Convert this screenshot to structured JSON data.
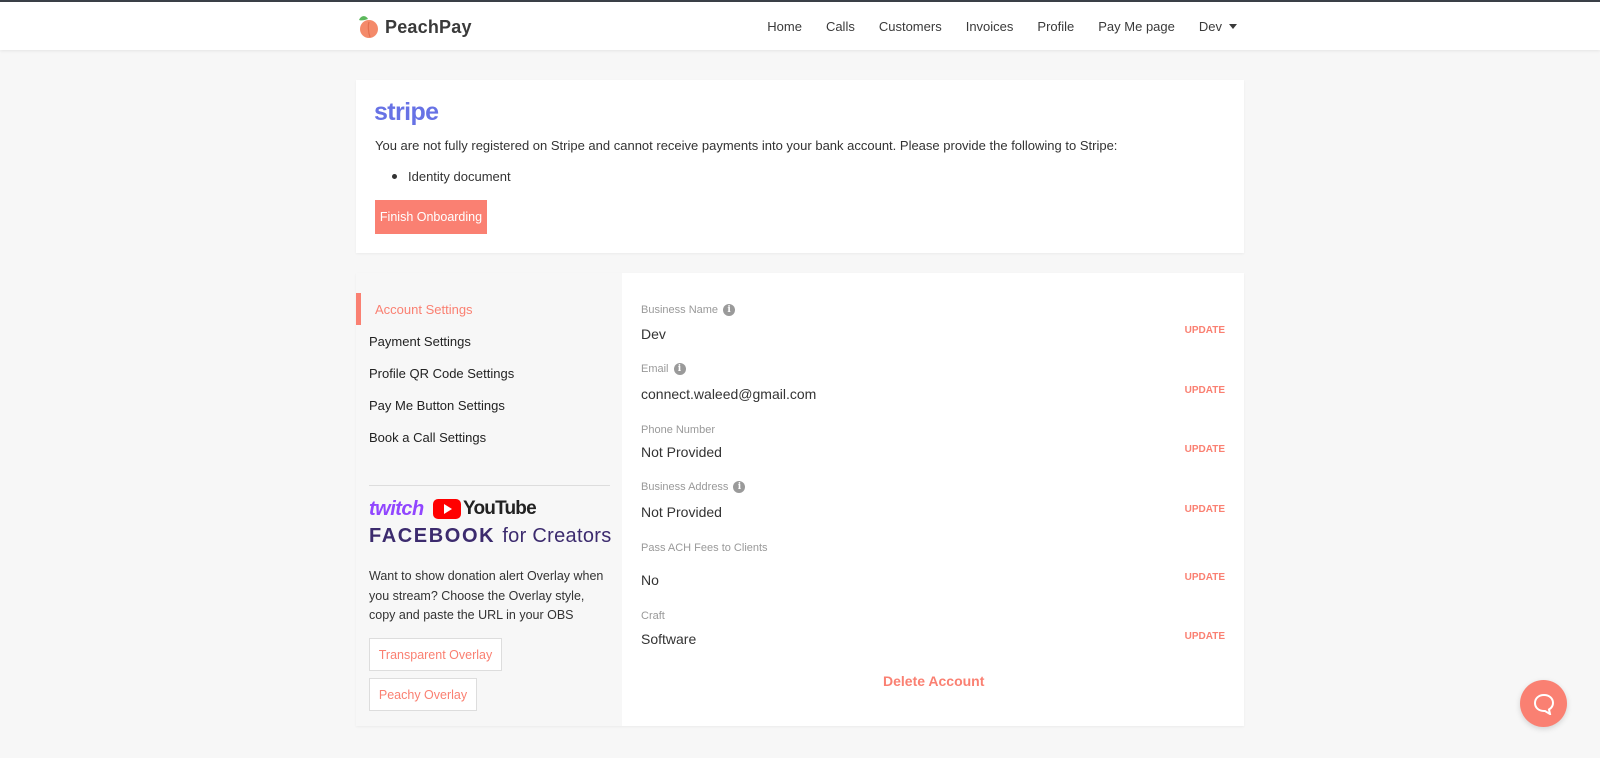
{
  "nav": {
    "brand": "PeachPay",
    "links": [
      "Home",
      "Calls",
      "Customers",
      "Invoices",
      "Profile",
      "Pay Me page"
    ],
    "user_menu": "Dev"
  },
  "stripe": {
    "logo": "stripe",
    "message": "You are not fully registered on Stripe and cannot receive payments into your bank account. Please provide the following to Stripe:",
    "requirements": [
      "Identity document"
    ],
    "button": "Finish Onboarding"
  },
  "sidebar": {
    "items": [
      "Account Settings",
      "Payment Settings",
      "Profile QR Code Settings",
      "Pay Me Button Settings",
      "Book a Call Settings"
    ],
    "promo": {
      "twitch": "twitch",
      "youtube": "YouTube",
      "facebook": "FACEBOOK",
      "for_creators": "for Creators",
      "description": "Want to show donation alert Overlay when you stream? Choose the Overlay style, copy and paste the URL in your OBS",
      "buttons": [
        "Transparent Overlay",
        "Peachy Overlay"
      ]
    }
  },
  "fields": [
    {
      "label": "Business Name",
      "value": "Dev",
      "action": "UPDATE"
    },
    {
      "label": "Email",
      "value": "connect.waleed@gmail.com",
      "action": "UPDATE"
    },
    {
      "label": "Phone Number",
      "value": "Not Provided",
      "action": "UPDATE"
    },
    {
      "label": "Business Address",
      "value": "Not Provided",
      "action": "UPDATE"
    },
    {
      "label": "Pass ACH Fees to Clients",
      "value": "No",
      "action": "UPDATE"
    },
    {
      "label": "Craft",
      "value": "Software",
      "action": "UPDATE"
    }
  ],
  "delete_label": "Delete Account",
  "info_glyph": "i",
  "colors": {
    "accent": "#fa8072",
    "stripe": "#6772e5",
    "twitch": "#9146ff",
    "youtube": "#ff0000",
    "facebook": "#3c2b6e"
  }
}
